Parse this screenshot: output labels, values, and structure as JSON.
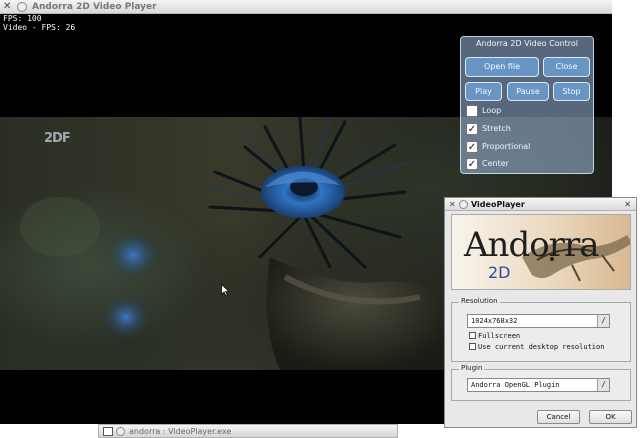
{
  "main_window": {
    "title": "Andorra 2D Video Player",
    "close_glyph": "✕",
    "fps_line": "FPS: 100",
    "video_fps_line": "Video - FPS: 26"
  },
  "video_control": {
    "title": "Andorra 2D Video Control",
    "buttons": {
      "open": "Open file",
      "close": "Close",
      "play": "Play",
      "pause": "Pause",
      "stop": "Stop"
    },
    "options": [
      {
        "label": "Loop",
        "checked": false
      },
      {
        "label": "Stretch",
        "checked": true
      },
      {
        "label": "Proportional",
        "checked": true
      },
      {
        "label": "Center",
        "checked": true
      }
    ],
    "check_glyph": "✓"
  },
  "video_overlay": {
    "channel_logo": "2DF"
  },
  "dialog": {
    "title": "VideoPlayer",
    "close_glyph": "✕",
    "logo": {
      "word": "Andorra",
      "sub": "2D"
    },
    "resolution": {
      "group_label": "Resolution",
      "value": "1024x768x32",
      "fullscreen_label": "Fullscreen",
      "desktop_label": "Use current desktop resolution"
    },
    "plugin": {
      "group_label": "Plugin",
      "value": "Andorra OpenGL Plugin"
    },
    "dropdown_glyph": "/",
    "buttons": {
      "cancel": "Cancel",
      "ok": "OK"
    }
  },
  "taskbar": {
    "title": "andorra : VideoPlayer.exe"
  },
  "colors": {
    "control_panel": "#a0bee1",
    "control_button": "#6ea0d7",
    "video_background": "#000000",
    "flower_blue": "#2f74c4"
  },
  "icons": [
    "close-icon",
    "window-menu-icon",
    "check-icon",
    "dropdown-icon",
    "mouse-pointer-icon"
  ]
}
